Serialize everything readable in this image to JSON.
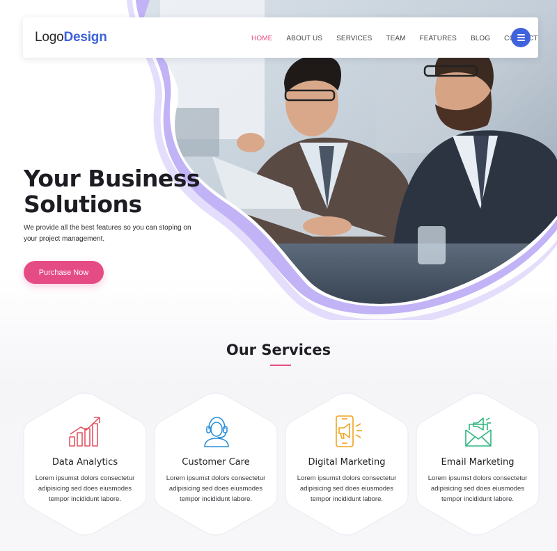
{
  "header": {
    "logo_light": "Logo",
    "logo_bold": "Design",
    "nav": [
      "HOME",
      "ABOUT US",
      "SERVICES",
      "TEAM",
      "FEATURES",
      "BLOG",
      "CONTACT"
    ],
    "active_nav": "HOME",
    "menu_icon": "hamburger-menu-icon"
  },
  "hero": {
    "title_line1": "Your Business",
    "title_line2": "Solutions",
    "subtitle": "We provide all the best features so you can stoping on your project management.",
    "cta_label": "Purchase Now",
    "image": "business-meeting-photo"
  },
  "services": {
    "title": "Our Services",
    "items": [
      {
        "title": "Data Analytics",
        "text": "Lorem ipsumst dolors consectetur adipisicing sed does eiusmodes tempor incididunt labore.",
        "icon": "bar-chart-growth-icon",
        "color": "#e25563"
      },
      {
        "title": "Customer Care",
        "text": "Lorem ipsumst dolors consectetur adipisicing sed does eiusmodes tempor incididunt labore.",
        "icon": "headset-support-icon",
        "color": "#2b8fd6"
      },
      {
        "title": "Digital Marketing",
        "text": "Lorem ipsumst dolors consectetur adipisicing sed does eiusmodes tempor incididunt labore.",
        "icon": "mobile-megaphone-icon",
        "color": "#f0a41f"
      },
      {
        "title": "Email Marketing",
        "text": "Lorem ipsumst dolors consectetur adipisicing sed does eiusmodes tempor incididunt labore.",
        "icon": "envelope-megaphone-icon",
        "color": "#2fb57e"
      }
    ]
  },
  "colors": {
    "brand_blue": "#3e63d9",
    "accent_pink": "#e54c86",
    "blob_purple": "#b7a4f2"
  }
}
